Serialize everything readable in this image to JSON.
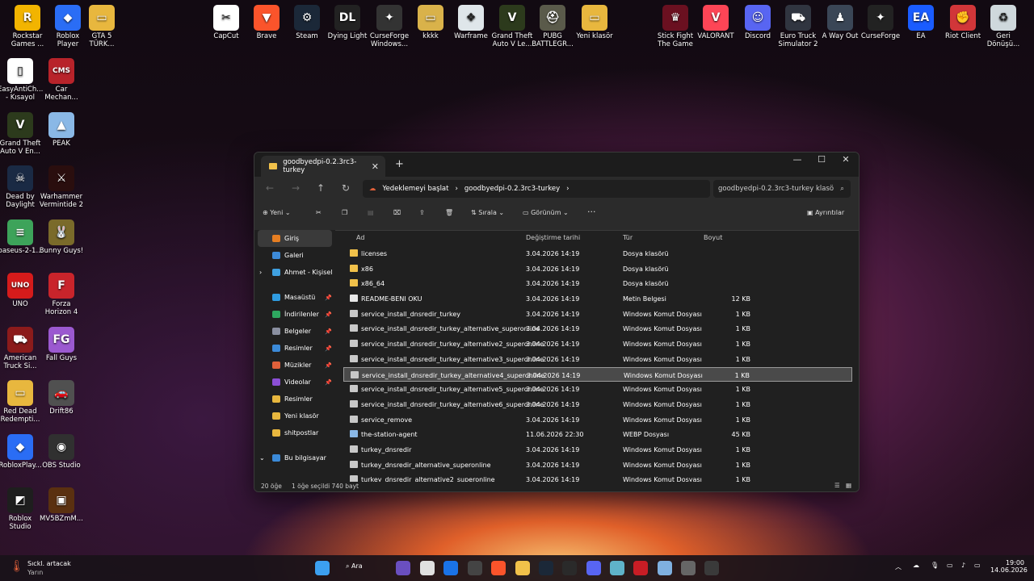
{
  "desktop": {
    "top_icons": [
      {
        "label": "Rockstar Games ...",
        "color": "#f2b400",
        "glyph": "R"
      },
      {
        "label": "Roblox Player",
        "color": "#2a6df5",
        "glyph": "◆"
      },
      {
        "label": "GTA 5 TÜRK...",
        "color": "#e8b73e",
        "glyph": "▭"
      },
      {
        "label": "CapCut",
        "color": "#ffffff",
        "glyph": "✂"
      },
      {
        "label": "Brave",
        "color": "#fb542b",
        "glyph": "▼"
      },
      {
        "label": "Steam",
        "color": "#1b2838",
        "glyph": "⚙"
      },
      {
        "label": "Dying Light",
        "color": "#222222",
        "glyph": "DL"
      },
      {
        "label": "CurseForge Windows...",
        "color": "#333333",
        "glyph": "✦"
      },
      {
        "label": "kkkk",
        "color": "#d9b24a",
        "glyph": "▭"
      },
      {
        "label": "Warframe",
        "color": "#dfe6ea",
        "glyph": "❖"
      },
      {
        "label": "Grand Theft Auto V Le...",
        "color": "#2c3a1c",
        "glyph": "V"
      },
      {
        "label": "PUBG BATTLEGR...",
        "color": "#5a5a4a",
        "glyph": "⛑"
      },
      {
        "label": "Yeni klasör",
        "color": "#e8b73e",
        "glyph": "▭"
      },
      {
        "label": "Stick Fight The Game",
        "color": "#6a1020",
        "glyph": "♛"
      },
      {
        "label": "VALORANT",
        "color": "#fd4556",
        "glyph": "V"
      },
      {
        "label": "Discord",
        "color": "#5865f2",
        "glyph": "☺"
      },
      {
        "label": "Euro Truck Simulator 2",
        "color": "#303540",
        "glyph": "⛟"
      },
      {
        "label": "A Way Out",
        "color": "#3a4656",
        "glyph": "♟"
      },
      {
        "label": "CurseForge",
        "color": "#222222",
        "glyph": "✦"
      },
      {
        "label": "EA",
        "color": "#1a5cff",
        "glyph": "EA"
      },
      {
        "label": "Riot Client",
        "color": "#d13639",
        "glyph": "✊"
      },
      {
        "label": "Geri Dönüşü...",
        "color": "#cfd8dc",
        "glyph": "♻"
      }
    ],
    "left_icons": [
      {
        "label": "EasyAntiCh... - Kısayol",
        "color": "#ffffff",
        "glyph": "▯"
      },
      {
        "label": "Car Mechan...",
        "color": "#b8232a",
        "glyph": "CMS"
      },
      {
        "label": "Grand Theft Auto V En...",
        "color": "#2c3a1c",
        "glyph": "V"
      },
      {
        "label": "PEAK",
        "color": "#8ab8e6",
        "glyph": "▲"
      },
      {
        "label": "Dead by Daylight",
        "color": "#1a2a44",
        "glyph": "☠"
      },
      {
        "label": "Warhammer Vermintide 2",
        "color": "#2a0e0e",
        "glyph": "⚔"
      },
      {
        "label": "baseus-2-1...",
        "color": "#3da35a",
        "glyph": "≡"
      },
      {
        "label": "Bunny Guys!",
        "color": "#7a6a2a",
        "glyph": "🐰"
      },
      {
        "label": "UNO",
        "color": "#d61b1b",
        "glyph": "UNO"
      },
      {
        "label": "Forza Horizon 4",
        "color": "#c9242b",
        "glyph": "F"
      },
      {
        "label": "American Truck Si...",
        "color": "#8b1b1b",
        "glyph": "⛟"
      },
      {
        "label": "Fall Guys",
        "color": "#9b59d0",
        "glyph": "FG"
      },
      {
        "label": "Red Dead Redempti...",
        "color": "#e8b73e",
        "glyph": "▭"
      },
      {
        "label": "Drift86",
        "color": "#505050",
        "glyph": "🚗"
      },
      {
        "label": "RobloxPlay...",
        "color": "#2a6df5",
        "glyph": "◆"
      },
      {
        "label": "OBS Studio",
        "color": "#303030",
        "glyph": "◉"
      },
      {
        "label": "Roblox Studio",
        "color": "#1e1e1e",
        "glyph": "◩"
      },
      {
        "label": "MV5BZmM...",
        "color": "#5a3010",
        "glyph": "▣"
      }
    ]
  },
  "explorer": {
    "tab_title": "goodbyedpi-0.2.3rc3-turkey",
    "new_tab": "+",
    "breadcrumb_backup": "Yedeklemeyi başlat",
    "breadcrumb_folder": "goodbyedpi-0.2.3rc3-turkey",
    "search_placeholder": "goodbyedpi-0.2.3rc3-turkey klasö",
    "toolbar": {
      "new": "Yeni",
      "sort": "Sırala",
      "view": "Görünüm",
      "more": "···",
      "details": "Ayrıntılar"
    },
    "sidebar": [
      {
        "label": "Giriş",
        "color": "#e67e22",
        "active": true,
        "pin": false
      },
      {
        "label": "Galeri",
        "color": "#3d8bd9",
        "pin": false
      },
      {
        "label": "Ahmet - Kişisel",
        "color": "#3fa0e0",
        "pin": false,
        "expand": "›"
      },
      {
        "label": "",
        "spacer": true
      },
      {
        "label": "Masaüstü",
        "color": "#2f9be0",
        "pin": true
      },
      {
        "label": "İndirilenler",
        "color": "#2ea860",
        "pin": true
      },
      {
        "label": "Belgeler",
        "color": "#8a8fa0",
        "pin": true
      },
      {
        "label": "Resimler",
        "color": "#3b8ad8",
        "pin": true
      },
      {
        "label": "Müzikler",
        "color": "#e0603a",
        "pin": true
      },
      {
        "label": "Videolar",
        "color": "#8b4fd6",
        "pin": true
      },
      {
        "label": "Resimler",
        "color": "#e8b73e",
        "pin": false
      },
      {
        "label": "Yeni klasör",
        "color": "#e8b73e",
        "pin": false
      },
      {
        "label": "shitpostlar",
        "color": "#e8b73e",
        "pin": false
      },
      {
        "label": "",
        "spacer": true
      },
      {
        "label": "Bu bilgisayar",
        "color": "#3b8ad8",
        "pin": false,
        "expand": "⌄"
      }
    ],
    "columns": [
      "Ad",
      "Değiştirme tarihi",
      "Tür",
      "Boyut"
    ],
    "files": [
      {
        "name": "licenses",
        "date": "3.04.2026 14:19",
        "type": "Dosya klasörü",
        "size": "",
        "kind": "folder"
      },
      {
        "name": "x86",
        "date": "3.04.2026 14:19",
        "type": "Dosya klasörü",
        "size": "",
        "kind": "folder"
      },
      {
        "name": "x86_64",
        "date": "3.04.2026 14:19",
        "type": "Dosya klasörü",
        "size": "",
        "kind": "folder"
      },
      {
        "name": "README-BENI OKU",
        "date": "3.04.2026 14:19",
        "type": "Metin Belgesi",
        "size": "12 KB",
        "kind": "text"
      },
      {
        "name": "service_install_dnsredir_turkey",
        "date": "3.04.2026 14:19",
        "type": "Windows Komut Dosyası",
        "size": "1 KB",
        "kind": "cmd"
      },
      {
        "name": "service_install_dnsredir_turkey_alternative_superonline",
        "date": "3.04.2026 14:19",
        "type": "Windows Komut Dosyası",
        "size": "1 KB",
        "kind": "cmd"
      },
      {
        "name": "service_install_dnsredir_turkey_alternative2_superonline",
        "date": "3.04.2026 14:19",
        "type": "Windows Komut Dosyası",
        "size": "1 KB",
        "kind": "cmd"
      },
      {
        "name": "service_install_dnsredir_turkey_alternative3_superonline",
        "date": "3.04.2026 14:19",
        "type": "Windows Komut Dosyası",
        "size": "1 KB",
        "kind": "cmd"
      },
      {
        "name": "service_install_dnsredir_turkey_alternative4_superonline",
        "date": "3.04.2026 14:19",
        "type": "Windows Komut Dosyası",
        "size": "1 KB",
        "kind": "cmd",
        "selected": true
      },
      {
        "name": "service_install_dnsredir_turkey_alternative5_superonline",
        "date": "3.04.2026 14:19",
        "type": "Windows Komut Dosyası",
        "size": "1 KB",
        "kind": "cmd"
      },
      {
        "name": "service_install_dnsredir_turkey_alternative6_superonline",
        "date": "3.04.2026 14:19",
        "type": "Windows Komut Dosyası",
        "size": "1 KB",
        "kind": "cmd"
      },
      {
        "name": "service_remove",
        "date": "3.04.2026 14:19",
        "type": "Windows Komut Dosyası",
        "size": "1 KB",
        "kind": "cmd"
      },
      {
        "name": "the-station-agent",
        "date": "11.06.2026 22:30",
        "type": "WEBP Dosyası",
        "size": "45 KB",
        "kind": "image"
      },
      {
        "name": "turkey_dnsredir",
        "date": "3.04.2026 14:19",
        "type": "Windows Komut Dosyası",
        "size": "1 KB",
        "kind": "cmd"
      },
      {
        "name": "turkey_dnsredir_alternative_superonline",
        "date": "3.04.2026 14:19",
        "type": "Windows Komut Dosyası",
        "size": "1 KB",
        "kind": "cmd"
      },
      {
        "name": "turkey_dnsredir_alternative2_superonline",
        "date": "3.04.2026 14:19",
        "type": "Windows Komut Dosyası",
        "size": "1 KB",
        "kind": "cmd"
      }
    ],
    "status": {
      "count": "20 öğe",
      "selected": "1 öğe seçildi  740 bayt"
    }
  },
  "taskbar": {
    "weather_title": "Sıckl. artacak",
    "weather_sub": "Yarın",
    "search_label": "Ara",
    "time": "19:00",
    "date": "14.06.2026"
  }
}
